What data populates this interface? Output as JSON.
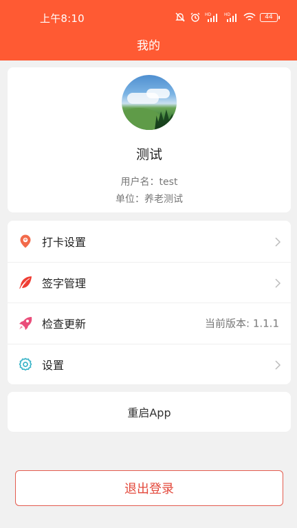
{
  "status_bar": {
    "time": "上午8:10",
    "battery": "44",
    "icons": [
      "mute-icon",
      "alarm-icon",
      "hd-signal-icon",
      "hd-signal-icon",
      "wifi-icon",
      "battery-icon"
    ]
  },
  "header": {
    "title": "我的",
    "background": "#ff5a33"
  },
  "profile": {
    "name": "测试",
    "username_line": "用户名：test",
    "unit_line": "单位：养老测试"
  },
  "menu": {
    "items": [
      {
        "label": "打卡设置",
        "icon": "location-pin-icon",
        "value": ""
      },
      {
        "label": "签字管理",
        "icon": "feather-icon",
        "value": ""
      },
      {
        "label": "检查更新",
        "icon": "rocket-icon",
        "value": "当前版本: 1.1.1"
      },
      {
        "label": "设置",
        "icon": "gear-icon",
        "value": ""
      }
    ]
  },
  "restart": {
    "label": "重启App"
  },
  "logout": {
    "label": "退出登录",
    "color": "#e3483b"
  }
}
